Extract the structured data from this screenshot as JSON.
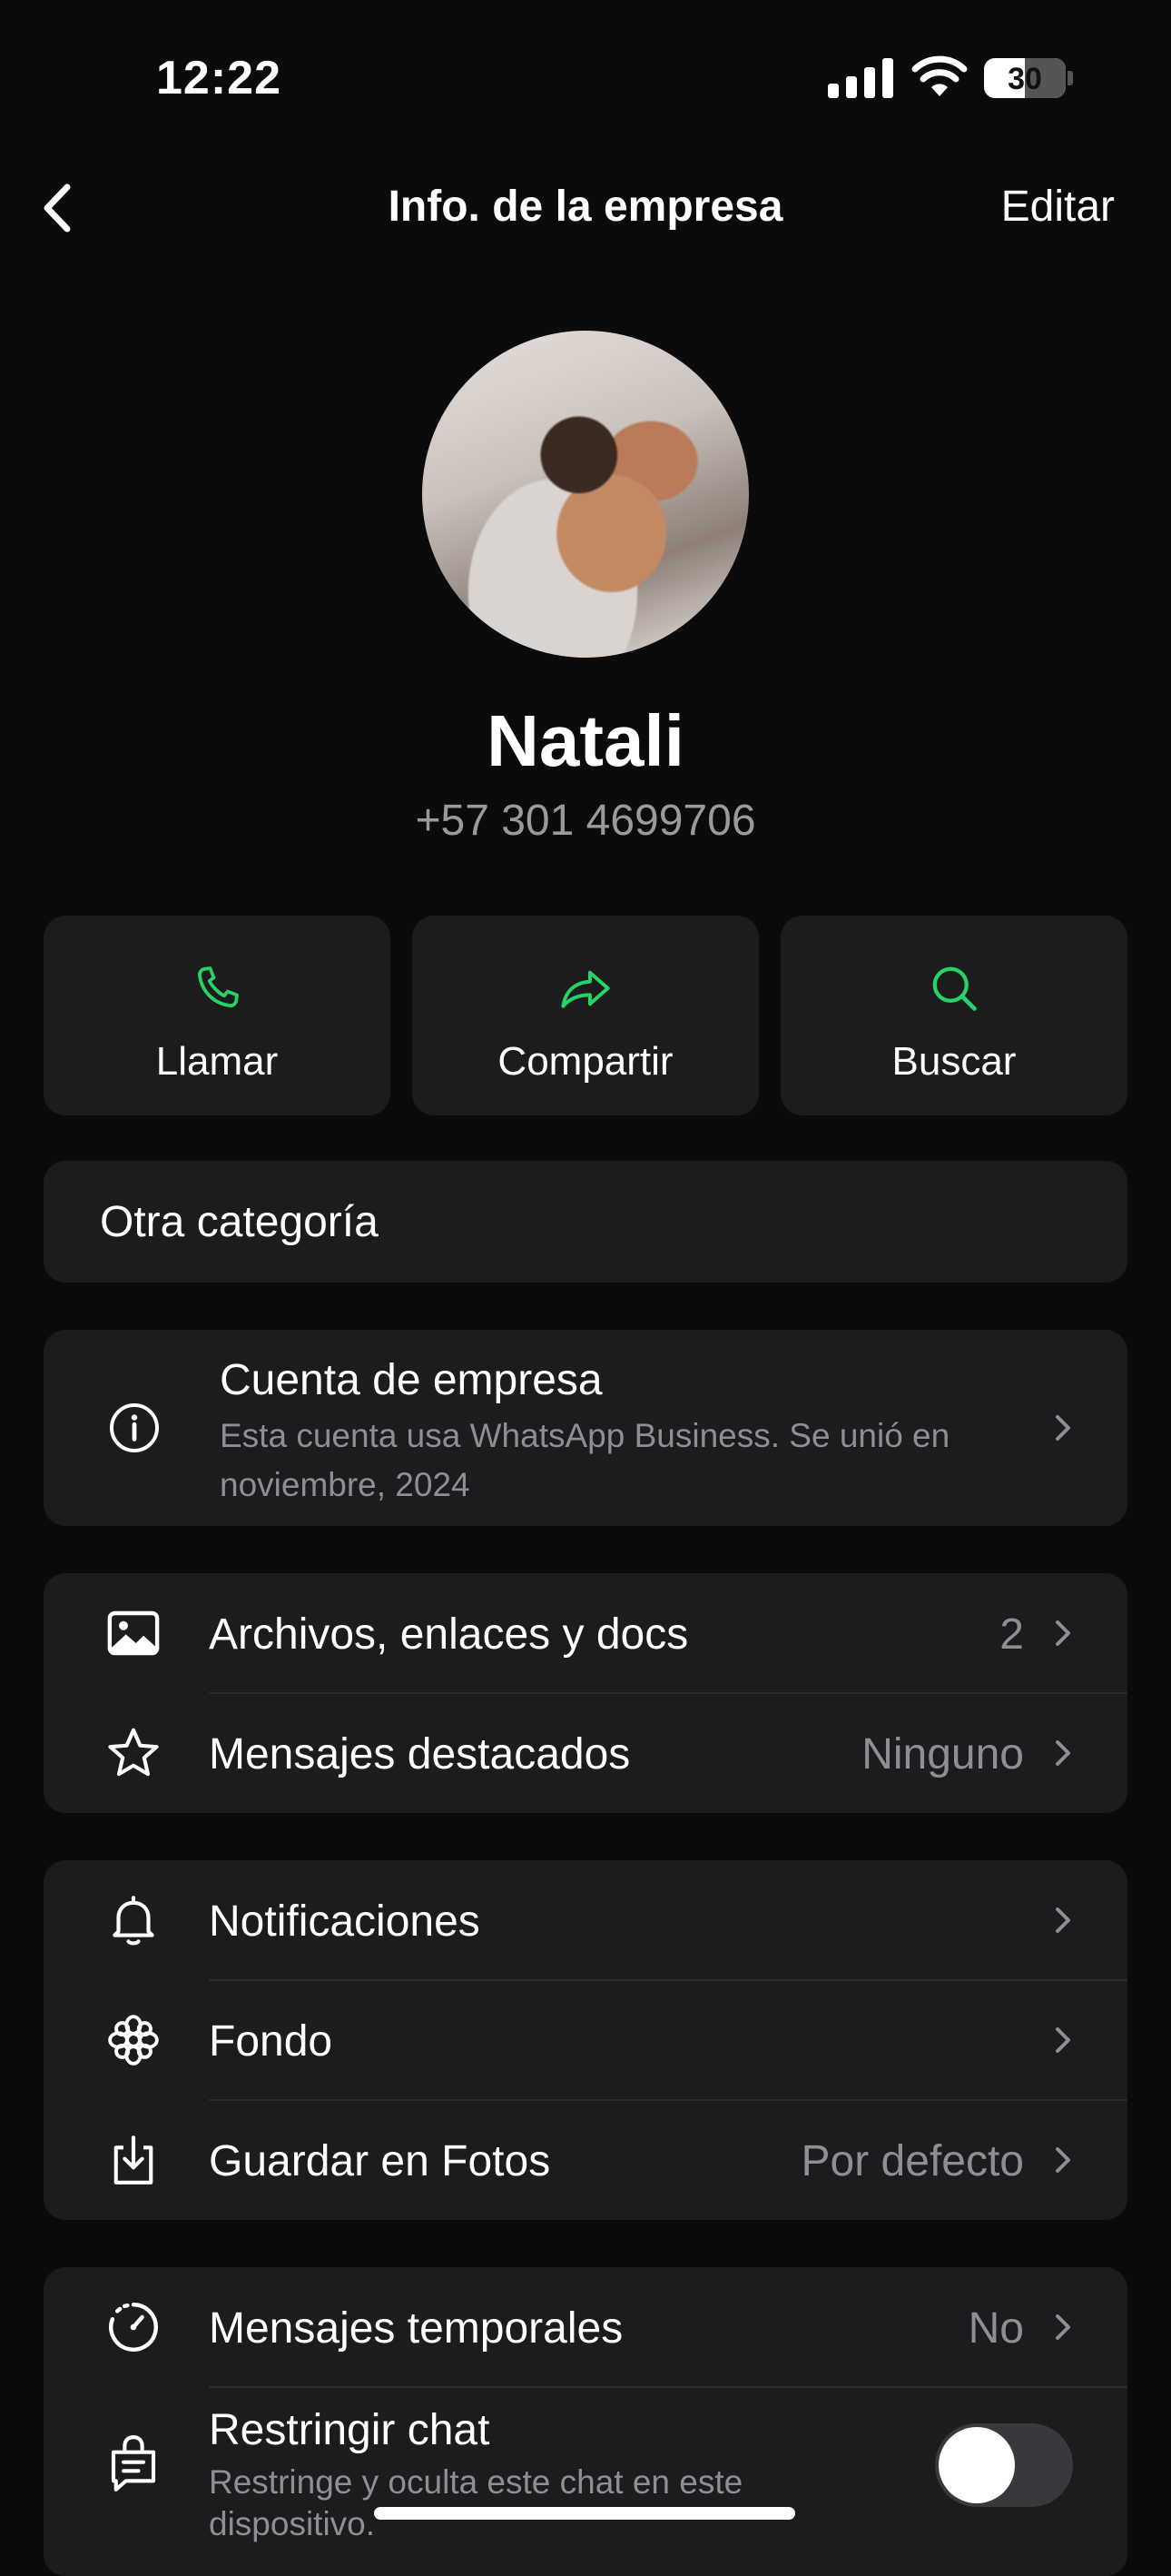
{
  "status": {
    "time": "12:22",
    "battery": "30"
  },
  "nav": {
    "title": "Info. de la empresa",
    "edit_label": "Editar"
  },
  "profile": {
    "name": "Natali",
    "phone": "+57 301 4699706"
  },
  "actions": [
    {
      "label": "Llamar",
      "icon": "phone-icon"
    },
    {
      "label": "Compartir",
      "icon": "share-icon"
    },
    {
      "label": "Buscar",
      "icon": "search-icon"
    }
  ],
  "category": "Otra categoría",
  "business": {
    "title": "Cuenta de empresa",
    "desc_line1": "Esta cuenta usa WhatsApp Business. Se unió en",
    "desc_line2": "noviembre, 2024"
  },
  "media_section": {
    "files": {
      "label": "Archivos, enlaces y docs",
      "value": "2"
    },
    "starred": {
      "label": "Mensajes destacados",
      "value": "Ninguno"
    }
  },
  "settings_section": {
    "notifications": {
      "label": "Notificaciones"
    },
    "wallpaper": {
      "label": "Fondo"
    },
    "save_photos": {
      "label": "Guardar en Fotos",
      "value": "Por defecto"
    }
  },
  "privacy_section": {
    "disappearing": {
      "label": "Mensajes temporales",
      "value": "No"
    },
    "lock_chat": {
      "label": "Restringir chat",
      "desc_line1": "Restringe y oculta este chat en este",
      "desc_line2": "dispositivo."
    }
  },
  "colors": {
    "accent": "#25d366",
    "background": "#0b0b0b",
    "card": "#1c1c1e",
    "secondary_text": "#8e8e93"
  }
}
